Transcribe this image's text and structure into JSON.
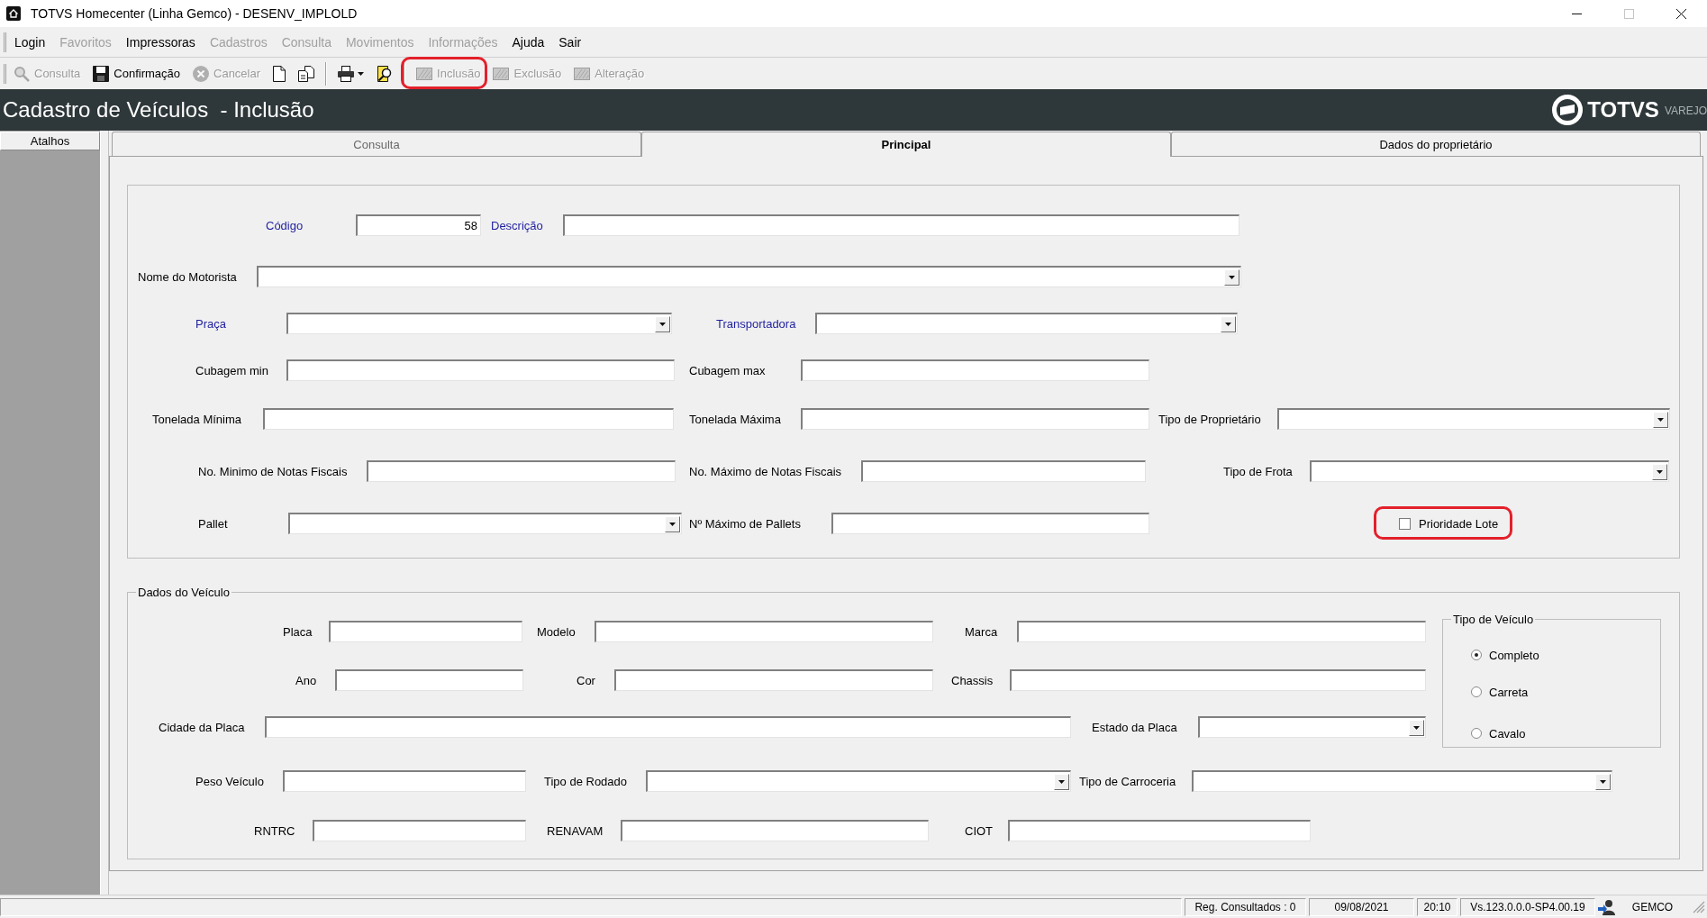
{
  "window": {
    "title": "TOTVS Homecenter (Linha Gemco) - DESENV_IMPLOLD",
    "controls": [
      {
        "kind": "minimize",
        "disabled": false
      },
      {
        "kind": "maximize",
        "disabled": true
      },
      {
        "kind": "close",
        "disabled": false
      }
    ]
  },
  "menu": [
    {
      "label": "Login",
      "disabled": false
    },
    {
      "label": "Favoritos",
      "disabled": true
    },
    {
      "label": "Impressoras",
      "disabled": false
    },
    {
      "label": "Cadastros",
      "disabled": true
    },
    {
      "label": "Consulta",
      "disabled": true
    },
    {
      "label": "Movimentos",
      "disabled": true
    },
    {
      "label": "Informações",
      "disabled": true
    },
    {
      "label": "Ajuda",
      "disabled": false
    },
    {
      "label": "Sair",
      "disabled": false
    }
  ],
  "toolbar": [
    [
      {
        "label": "Consulta",
        "disabled": true,
        "highlighted": false
      },
      {
        "label": "Confirmação",
        "disabled": false,
        "highlighted": false
      },
      {
        "label": "Cancelar",
        "disabled": true,
        "highlighted": false
      },
      {
        "disabled": false,
        "highlighted": false
      },
      {
        "disabled": false,
        "highlighted": false
      }
    ],
    [
      {
        "disabled": false,
        "highlighted": false
      },
      {
        "disabled": false,
        "highlighted": false
      }
    ],
    [
      {
        "label": "Inclusão",
        "disabled": true,
        "highlighted": true
      },
      {
        "label": "Exclusão",
        "disabled": true,
        "highlighted": false
      },
      {
        "label": "Alteração",
        "disabled": true,
        "highlighted": false
      }
    ]
  ],
  "header": {
    "title": "Cadastro de Veículos  - Inclusão",
    "brand": "TOTVS",
    "brand_suffix": "VAREJO"
  },
  "sidebar": {
    "button": "Atalhos"
  },
  "tabs": [
    {
      "label": "Consulta",
      "selected": false,
      "disabled": true
    },
    {
      "label": "Principal",
      "selected": true,
      "disabled": false
    },
    {
      "label": "Dados do proprietário",
      "selected": false,
      "disabled": false
    }
  ],
  "main_form": {
    "rows": [
      [
        {
          "kind": "number",
          "label": "Código",
          "required": true,
          "value": "58",
          "highlighted": false
        },
        {
          "kind": "text",
          "label": "Descrição",
          "required": true,
          "highlighted": false
        }
      ],
      [
        {
          "kind": "combo",
          "label": "Nome do Motorista",
          "required": false,
          "highlighted": false
        }
      ],
      [
        {
          "kind": "combo",
          "label": "Praça",
          "required": true,
          "highlighted": false
        },
        {
          "kind": "combo",
          "label": "Transportadora",
          "required": true,
          "highlighted": false
        }
      ],
      [
        {
          "kind": "text",
          "label": "Cubagem min",
          "required": false,
          "highlighted": false
        },
        {
          "kind": "text",
          "label": "Cubagem max",
          "required": false,
          "highlighted": false
        }
      ],
      [
        {
          "kind": "text",
          "label": "Tonelada Mínima",
          "required": false,
          "highlighted": false
        },
        {
          "kind": "text",
          "label": "Tonelada Máxima",
          "required": false,
          "highlighted": false
        },
        {
          "kind": "combo",
          "label": "Tipo de Proprietário",
          "required": false,
          "highlighted": false
        }
      ],
      [
        {
          "kind": "text",
          "label": "No. Minimo de Notas Fiscais",
          "required": false,
          "highlighted": false
        },
        {
          "kind": "text",
          "label": "No. Máximo de Notas Fiscais",
          "required": false,
          "highlighted": false
        },
        {
          "kind": "combo",
          "label": "Tipo de Frota",
          "required": false,
          "highlighted": false
        }
      ],
      [
        {
          "kind": "combo",
          "label": "Pallet",
          "required": false,
          "highlighted": false
        },
        {
          "kind": "text",
          "label": "Nº Máximo de Pallets",
          "required": false,
          "highlighted": false
        },
        {
          "kind": "checkbox",
          "label": "Prioridade Lote",
          "required": false,
          "checked": false,
          "highlighted": true
        }
      ]
    ]
  },
  "vehicle": {
    "legend": "Dados do Veículo",
    "rows": [
      [
        {
          "kind": "text",
          "label": "Placa",
          "required": false
        },
        {
          "kind": "text",
          "label": "Modelo",
          "required": false
        },
        {
          "kind": "text",
          "label": "Marca",
          "required": false
        }
      ],
      [
        {
          "kind": "text",
          "label": "Ano",
          "required": false
        },
        {
          "kind": "text",
          "label": "Cor",
          "required": false
        },
        {
          "kind": "text",
          "label": "Chassis",
          "required": false
        }
      ],
      [
        {
          "kind": "text",
          "label": "Cidade da Placa",
          "required": false
        },
        {
          "kind": "combo",
          "label": "Estado da Placa",
          "required": false
        }
      ],
      [
        {
          "kind": "text",
          "label": "Peso Veículo",
          "required": false
        },
        {
          "kind": "combo",
          "label": "Tipo de Rodado",
          "required": false
        },
        {
          "kind": "combo",
          "label": "Tipo de Carroceria",
          "required": false
        }
      ],
      [
        {
          "kind": "text",
          "label": "RNTRC",
          "required": false
        },
        {
          "kind": "text",
          "label": "RENAVAM",
          "required": false
        },
        {
          "kind": "text",
          "label": "CIOT",
          "required": false
        }
      ]
    ],
    "vehicle_type": {
      "legend": "Tipo de Veículo",
      "options": [
        {
          "label": "Completo",
          "selected": true
        },
        {
          "label": "Carreta",
          "selected": false
        },
        {
          "label": "Cavalo",
          "selected": false
        }
      ]
    }
  },
  "status_bar": {
    "cells": [
      "Reg. Consultados : 0",
      "09/08/2021",
      "20:10",
      "Vs.123.0.0.0-SP4.00.19"
    ],
    "user": "GEMCO"
  }
}
